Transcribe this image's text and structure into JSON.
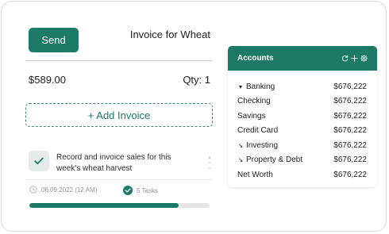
{
  "invoice": {
    "send_label": "Send",
    "title": "Invoice for Wheat",
    "amount": "$589.00",
    "qty": "Qty: 1",
    "add_invoice_label": "+ Add Invoice"
  },
  "task": {
    "text": "Record and invoice sales for this week's wheat harvest",
    "date": "06.09.2022 (12 AM)",
    "tasks_count": "5 Tasks",
    "progress": 0.83
  },
  "accounts": {
    "title": "Accounts",
    "icons": [
      "refresh-icon",
      "plus-icon",
      "gear-icon"
    ],
    "rows": [
      {
        "name": "Banking",
        "value": "$676,222",
        "glyph": "▾",
        "icon": "caret-down-icon"
      },
      {
        "name": "Checking",
        "value": "$676,222",
        "glyph": "",
        "icon": ""
      },
      {
        "name": "Savings",
        "value": "$676,222",
        "glyph": "",
        "icon": ""
      },
      {
        "name": "Credit Card",
        "value": "$676,222",
        "glyph": "",
        "icon": ""
      },
      {
        "name": "Investing",
        "value": "$676,222",
        "glyph": "↘",
        "icon": "arrow-down-right-icon"
      },
      {
        "name": "Property & Debt",
        "value": "$676,222",
        "glyph": "↘",
        "icon": "arrow-down-right-icon"
      },
      {
        "name": "Net Worth",
        "value": "$676,222",
        "glyph": "",
        "icon": ""
      }
    ]
  },
  "colors": {
    "accent": "#1d7a67",
    "track": "#e3e6e5",
    "muted_text": "#8c9390"
  }
}
